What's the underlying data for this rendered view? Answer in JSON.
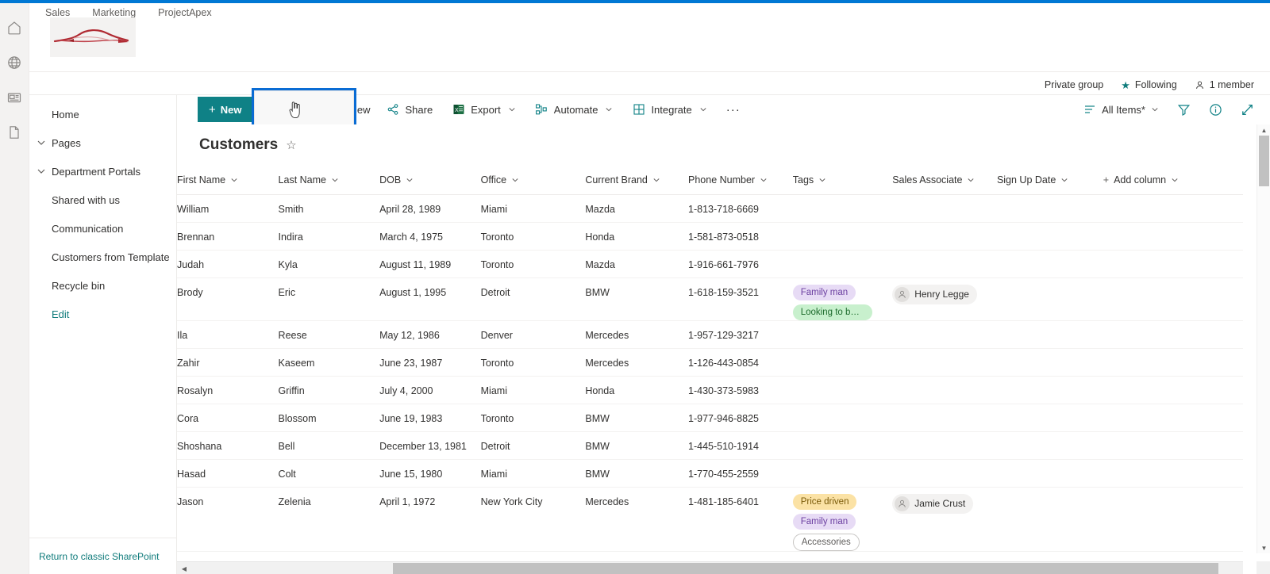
{
  "rail": {
    "items": [
      {
        "name": "home-icon",
        "label": "Home"
      },
      {
        "name": "globe-icon",
        "label": "My sites"
      },
      {
        "name": "news-icon",
        "label": "News"
      },
      {
        "name": "document-icon",
        "label": "Files"
      }
    ]
  },
  "header": {
    "nav": [
      {
        "label": "Sales"
      },
      {
        "label": "Marketing"
      },
      {
        "label": "ProjectApex"
      }
    ],
    "logo_alt": "car-sketch-logo"
  },
  "group_meta": {
    "privacy": "Private group",
    "following": "Following",
    "members": "1 member"
  },
  "sidebar": {
    "items": [
      {
        "label": "Home",
        "expandable": false
      },
      {
        "label": "Pages",
        "expandable": true
      },
      {
        "label": "Department Portals",
        "expandable": true
      },
      {
        "label": "Shared with us",
        "expandable": false
      },
      {
        "label": "Communication",
        "expandable": false
      },
      {
        "label": "Customers from Template",
        "expandable": false
      },
      {
        "label": "Recycle bin",
        "expandable": false
      },
      {
        "label": "Edit",
        "expandable": false
      }
    ],
    "footer_link": "Return to classic SharePoint"
  },
  "commandbar": {
    "new_label": "New",
    "edit_grid_label": "Edit in grid view",
    "share_label": "Share",
    "export_label": "Export",
    "automate_label": "Automate",
    "integrate_label": "Integrate",
    "overflow_label": "···",
    "view_label": "All Items*",
    "filter_label": "Filter",
    "info_label": "Details",
    "expand_label": "Expand"
  },
  "list": {
    "title": "Customers",
    "favorite_label": "Favorite",
    "columns": [
      {
        "label": "First Name"
      },
      {
        "label": "Last Name"
      },
      {
        "label": "DOB"
      },
      {
        "label": "Office"
      },
      {
        "label": "Current Brand"
      },
      {
        "label": "Phone Number"
      },
      {
        "label": "Tags"
      },
      {
        "label": "Sales Associate"
      },
      {
        "label": "Sign Up Date"
      },
      {
        "label": "Add column"
      }
    ],
    "rows": [
      {
        "first_name": "William",
        "last_name": "Smith",
        "dob": "April 28, 1989",
        "office": "Miami",
        "brand": "Mazda",
        "phone": "1-813-718-6669",
        "tags": [],
        "associate": "",
        "signup": ""
      },
      {
        "first_name": "Brennan",
        "last_name": "Indira",
        "dob": "March 4, 1975",
        "office": "Toronto",
        "brand": "Honda",
        "phone": "1-581-873-0518",
        "tags": [],
        "associate": "",
        "signup": ""
      },
      {
        "first_name": "Judah",
        "last_name": "Kyla",
        "dob": "August 11, 1989",
        "office": "Toronto",
        "brand": "Mazda",
        "phone": "1-916-661-7976",
        "tags": [],
        "associate": "",
        "signup": ""
      },
      {
        "first_name": "Brody",
        "last_name": "Eric",
        "dob": "August 1, 1995",
        "office": "Detroit",
        "brand": "BMW",
        "phone": "1-618-159-3521",
        "tags": [
          {
            "text": "Family man",
            "color": "purple"
          },
          {
            "text": "Looking to buy s...",
            "color": "green"
          }
        ],
        "associate": "Henry Legge",
        "signup": ""
      },
      {
        "first_name": "Ila",
        "last_name": "Reese",
        "dob": "May 12, 1986",
        "office": "Denver",
        "brand": "Mercedes",
        "phone": "1-957-129-3217",
        "tags": [],
        "associate": "",
        "signup": ""
      },
      {
        "first_name": "Zahir",
        "last_name": "Kaseem",
        "dob": "June 23, 1987",
        "office": "Toronto",
        "brand": "Mercedes",
        "phone": "1-126-443-0854",
        "tags": [],
        "associate": "",
        "signup": ""
      },
      {
        "first_name": "Rosalyn",
        "last_name": "Griffin",
        "dob": "July 4, 2000",
        "office": "Miami",
        "brand": "Honda",
        "phone": "1-430-373-5983",
        "tags": [],
        "associate": "",
        "signup": ""
      },
      {
        "first_name": "Cora",
        "last_name": "Blossom",
        "dob": "June 19, 1983",
        "office": "Toronto",
        "brand": "BMW",
        "phone": "1-977-946-8825",
        "tags": [],
        "associate": "",
        "signup": ""
      },
      {
        "first_name": "Shoshana",
        "last_name": "Bell",
        "dob": "December 13, 1981",
        "office": "Detroit",
        "brand": "BMW",
        "phone": "1-445-510-1914",
        "tags": [],
        "associate": "",
        "signup": ""
      },
      {
        "first_name": "Hasad",
        "last_name": "Colt",
        "dob": "June 15, 1980",
        "office": "Miami",
        "brand": "BMW",
        "phone": "1-770-455-2559",
        "tags": [],
        "associate": "",
        "signup": ""
      },
      {
        "first_name": "Jason",
        "last_name": "Zelenia",
        "dob": "April 1, 1972",
        "office": "New York City",
        "brand": "Mercedes",
        "phone": "1-481-185-6401",
        "tags": [
          {
            "text": "Price driven",
            "color": "yellow"
          },
          {
            "text": "Family man",
            "color": "purple"
          },
          {
            "text": "Accessories",
            "color": "outline"
          }
        ],
        "associate": "Jamie Crust",
        "signup": ""
      }
    ]
  },
  "colors": {
    "accent_teal": "#0f8186",
    "highlight_blue": "#0a6cd4",
    "top_strip": "#0078d4",
    "tag_purple_bg": "#e7dbf5",
    "tag_green_bg": "#c8f0cd",
    "tag_yellow_bg": "#fbe2a5"
  }
}
